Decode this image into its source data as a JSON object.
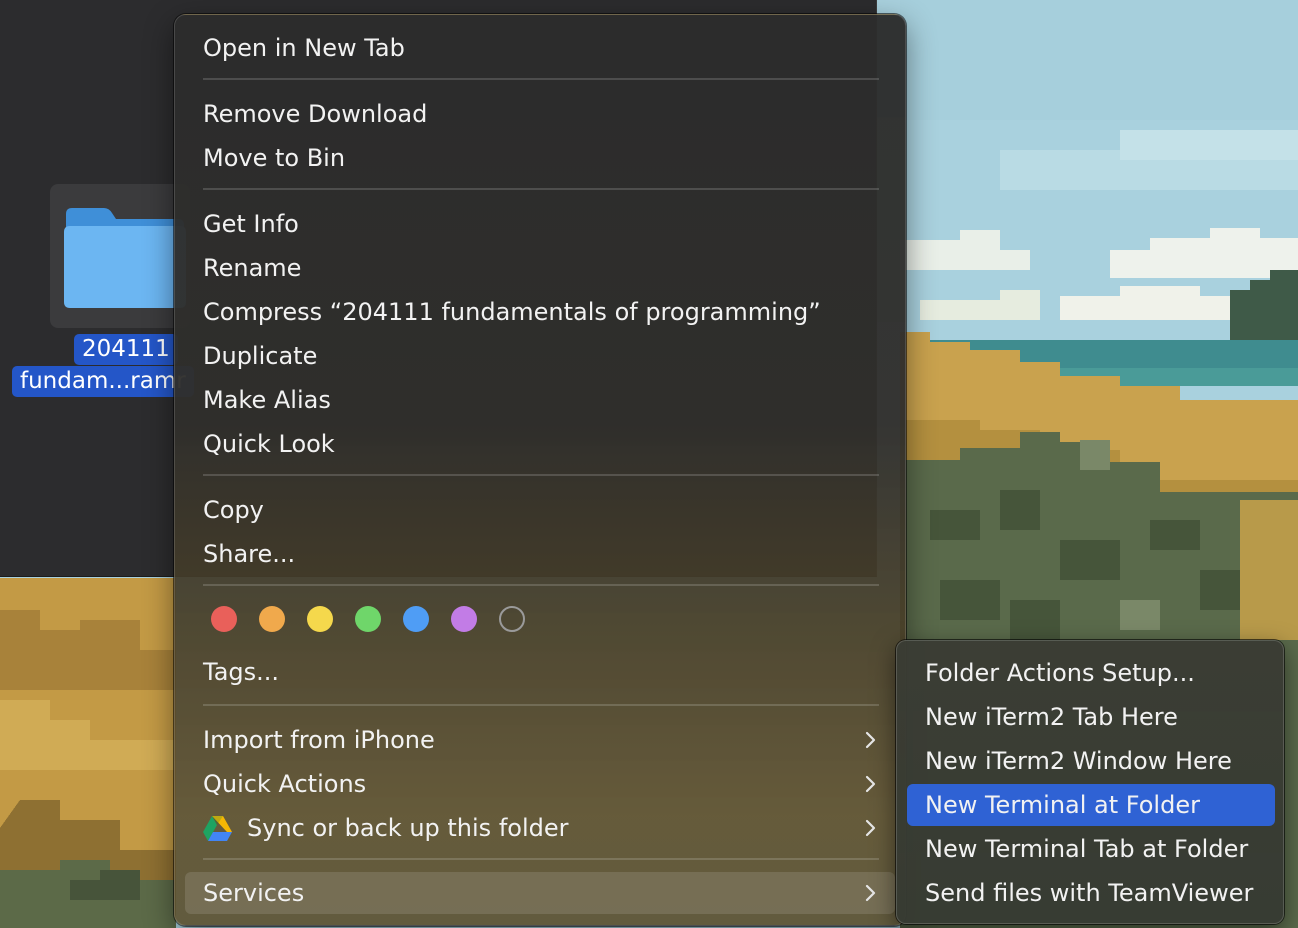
{
  "finder": {
    "folder_label_line1": "204111",
    "folder_label_line2": "fundam...ramr",
    "folder_icon": "folder-icon"
  },
  "context_menu": {
    "open_new_tab": "Open in New Tab",
    "remove_download": "Remove Download",
    "move_to_bin": "Move to Bin",
    "get_info": "Get Info",
    "rename": "Rename",
    "compress": "Compress “204111 fundamentals of programming”",
    "duplicate": "Duplicate",
    "make_alias": "Make Alias",
    "quick_look": "Quick Look",
    "copy": "Copy",
    "share": "Share...",
    "tags_label": "Tags...",
    "tag_colors": [
      "#e9605a",
      "#f0a94c",
      "#f5d84c",
      "#6fd66a",
      "#4f9df5",
      "#c27ce6"
    ],
    "import_iphone": "Import from iPhone",
    "quick_actions": "Quick Actions",
    "sync_backup": "Sync or back up this folder",
    "sync_icon": "google-drive-icon",
    "services": "Services",
    "submenu_icon": "chevron-right-icon"
  },
  "services_submenu": {
    "items": [
      "Folder Actions Setup...",
      "New iTerm2 Tab Here",
      "New iTerm2 Window Here",
      "New Terminal at Folder",
      "New Terminal Tab at Folder",
      "Send files with TeamViewer"
    ],
    "selected_index": 3,
    "selection_color": "#2f62d4"
  }
}
